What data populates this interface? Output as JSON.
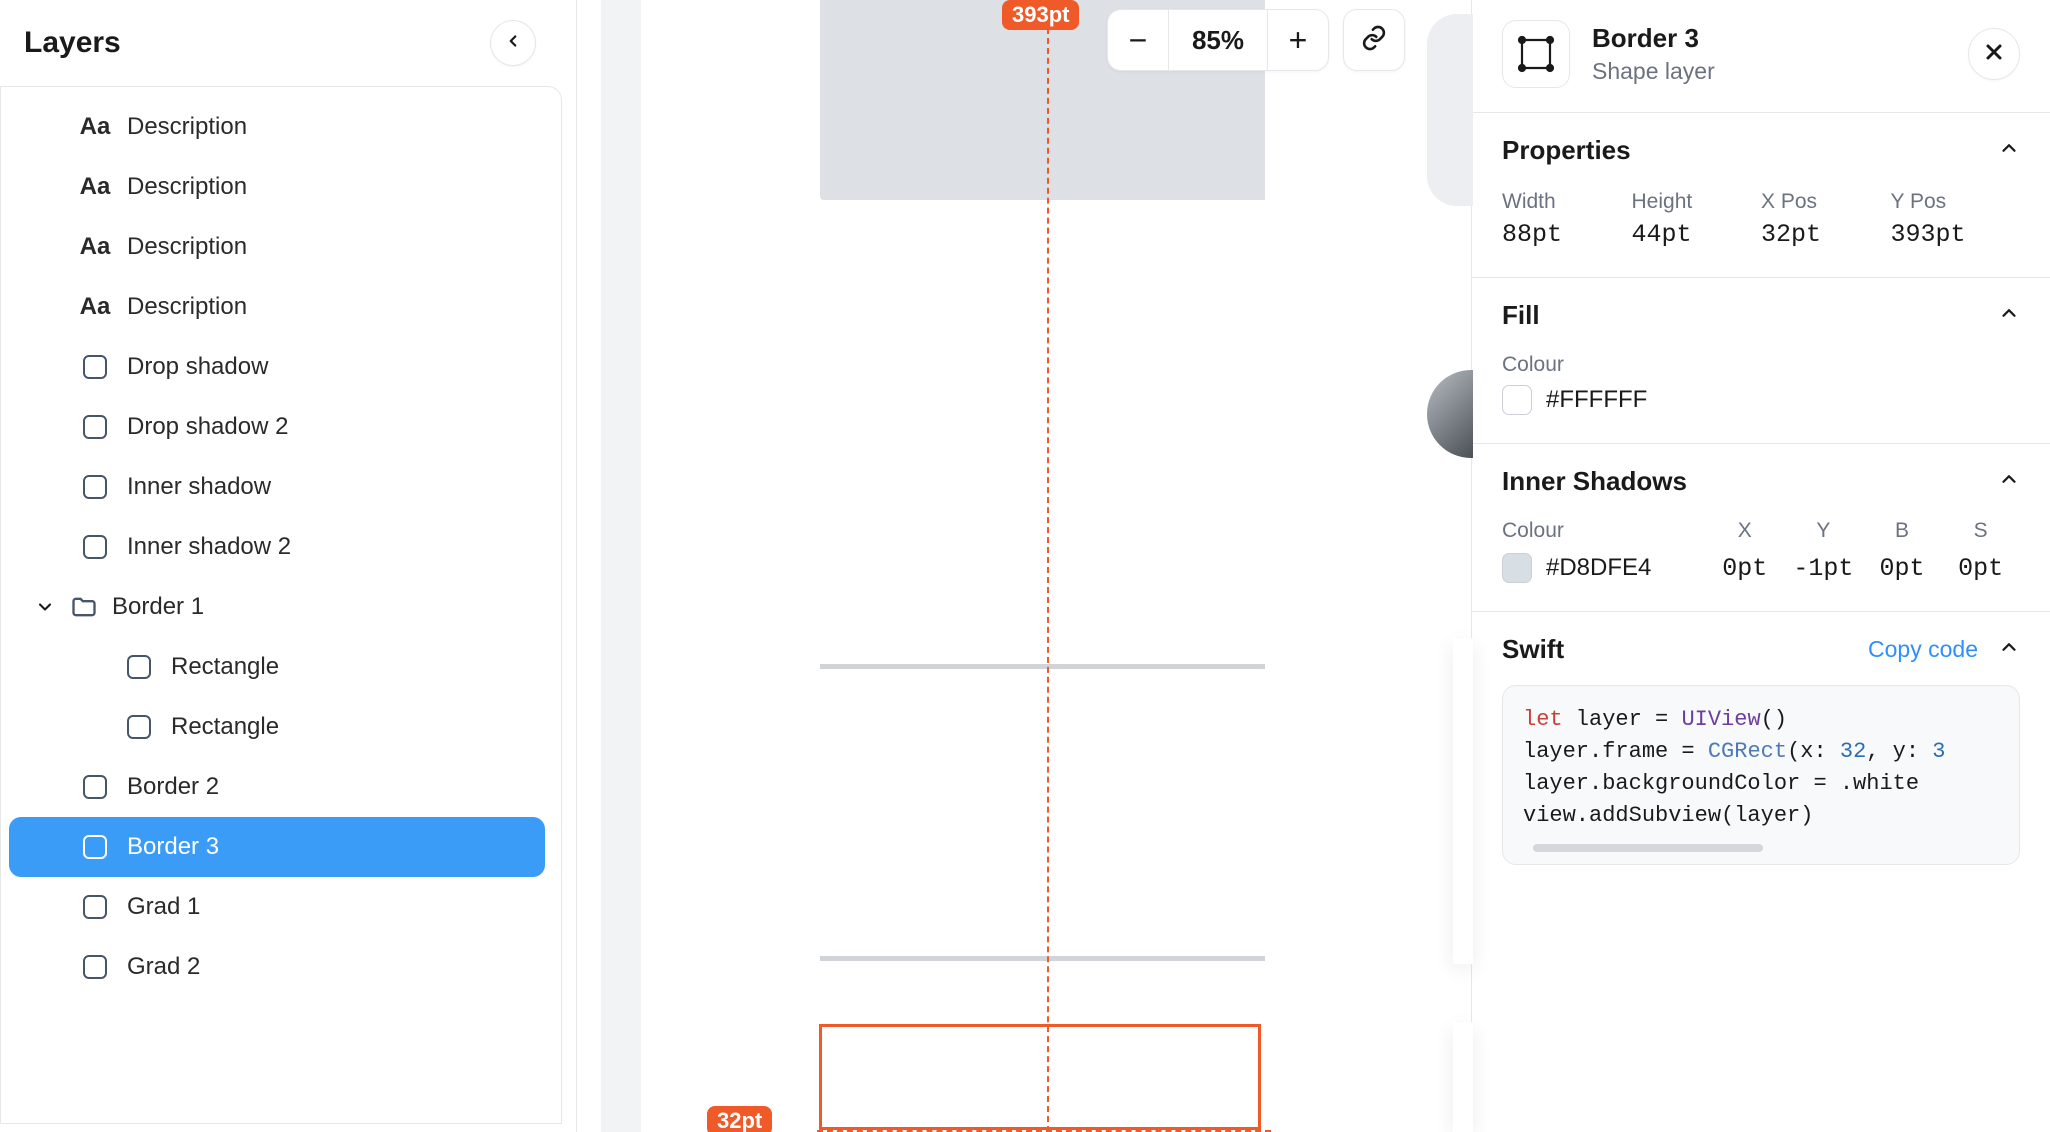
{
  "sidebar": {
    "title": "Layers",
    "items": [
      {
        "type": "text",
        "label": "Description"
      },
      {
        "type": "text",
        "label": "Description"
      },
      {
        "type": "text",
        "label": "Description"
      },
      {
        "type": "text",
        "label": "Description"
      },
      {
        "type": "shape",
        "label": "Drop shadow"
      },
      {
        "type": "shape",
        "label": "Drop shadow 2"
      },
      {
        "type": "shape",
        "label": "Inner shadow"
      },
      {
        "type": "shape",
        "label": "Inner shadow 2"
      },
      {
        "type": "group",
        "label": "Border 1"
      },
      {
        "type": "shape",
        "label": "Rectangle",
        "indent": true
      },
      {
        "type": "shape",
        "label": "Rectangle",
        "indent": true
      },
      {
        "type": "shape",
        "label": "Border 2"
      },
      {
        "type": "shape",
        "label": "Border 3",
        "selected": true
      },
      {
        "type": "shape",
        "label": "Grad 1"
      },
      {
        "type": "shape",
        "label": "Grad 2"
      }
    ]
  },
  "canvas": {
    "zoom": "85%",
    "dim_top": "393pt",
    "dim_bottom": "32pt"
  },
  "inspector": {
    "title": "Border 3",
    "subtitle": "Shape layer",
    "properties": {
      "heading": "Properties",
      "width_label": "Width",
      "width": "88pt",
      "height_label": "Height",
      "height": "44pt",
      "xpos_label": "X Pos",
      "xpos": "32pt",
      "ypos_label": "Y Pos",
      "ypos": "393pt"
    },
    "fill": {
      "heading": "Fill",
      "colour_label": "Colour",
      "colour": "#FFFFFF"
    },
    "inner_shadows": {
      "heading": "Inner Shadows",
      "colour_label": "Colour",
      "colour": "#D8DFE4",
      "x_label": "X",
      "x": "0pt",
      "y_label": "Y",
      "y": "-1pt",
      "b_label": "B",
      "b": "0pt",
      "s_label": "S",
      "s": "0pt"
    },
    "code": {
      "heading": "Swift",
      "copy_label": "Copy code",
      "l1_let": "let",
      "l1_rest": " layer = ",
      "l1_type": "UIView",
      "l1_end": "()",
      "l2_a": "layer.frame = ",
      "l2_fn": "CGRect",
      "l2_b": "(x: ",
      "l2_n1": "32",
      "l2_c": ", y: ",
      "l2_n2": "3",
      "l3": "layer.backgroundColor = .white",
      "l4": "view.addSubview(layer)"
    }
  }
}
